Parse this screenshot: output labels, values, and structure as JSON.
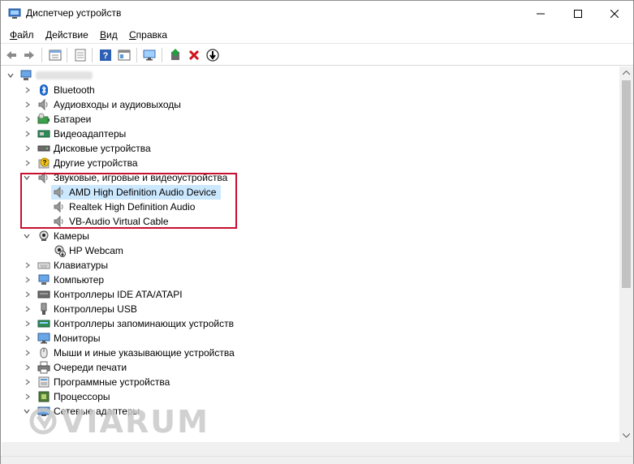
{
  "window": {
    "title": "Диспетчер устройств",
    "controls": {
      "minimize": "minimize",
      "maximize": "maximize",
      "close": "close"
    }
  },
  "menu": [
    {
      "key": "Ф",
      "rest": "айл"
    },
    {
      "key": "Д",
      "rest": "ействие"
    },
    {
      "key": "В",
      "rest": "ид"
    },
    {
      "key": "С",
      "rest": "правка"
    }
  ],
  "toolbar": [
    "back-icon",
    "forward-icon",
    "properties-icon",
    "show-hidden-icon",
    "help-icon",
    "view-icon",
    "monitor-icon",
    "update-driver-icon",
    "uninstall-icon",
    "scan-icon"
  ],
  "tree": {
    "root": "",
    "categories": [
      {
        "label": "Bluetooth",
        "icon": "bluetooth-icon",
        "expanded": false,
        "children": []
      },
      {
        "label": "Аудиовходы и аудиовыходы",
        "icon": "speaker-icon",
        "expanded": false,
        "children": []
      },
      {
        "label": "Батареи",
        "icon": "battery-icon",
        "expanded": false,
        "children": []
      },
      {
        "label": "Видеоадаптеры",
        "icon": "display-adapter-icon",
        "expanded": false,
        "children": []
      },
      {
        "label": "Дисковые устройства",
        "icon": "disk-icon",
        "expanded": false,
        "children": []
      },
      {
        "label": "Другие устройства",
        "icon": "unknown-device-icon",
        "expanded": false,
        "children": []
      },
      {
        "label": "Звуковые, игровые и видеоустройства",
        "icon": "speaker-icon",
        "expanded": true,
        "children": [
          {
            "label": "AMD High Definition Audio Device",
            "icon": "speaker-icon",
            "selected": true
          },
          {
            "label": "Realtek High Definition Audio",
            "icon": "speaker-icon",
            "selected": false
          },
          {
            "label": "VB-Audio Virtual Cable",
            "icon": "speaker-icon",
            "selected": false
          }
        ]
      },
      {
        "label": "Камеры",
        "icon": "camera-icon",
        "expanded": true,
        "children": [
          {
            "label": "HP Webcam",
            "icon": "webcam-icon",
            "selected": false
          }
        ]
      },
      {
        "label": "Клавиатуры",
        "icon": "keyboard-icon",
        "expanded": false,
        "children": []
      },
      {
        "label": "Компьютер",
        "icon": "computer-icon",
        "expanded": false,
        "children": []
      },
      {
        "label": "Контроллеры IDE ATA/ATAPI",
        "icon": "ide-controller-icon",
        "expanded": false,
        "children": []
      },
      {
        "label": "Контроллеры USB",
        "icon": "usb-icon",
        "expanded": false,
        "children": []
      },
      {
        "label": "Контроллеры запоминающих устройств",
        "icon": "storage-controller-icon",
        "expanded": false,
        "children": []
      },
      {
        "label": "Мониторы",
        "icon": "monitor-icon",
        "expanded": false,
        "children": []
      },
      {
        "label": "Мыши и иные указывающие устройства",
        "icon": "mouse-icon",
        "expanded": false,
        "children": []
      },
      {
        "label": "Очереди печати",
        "icon": "printer-icon",
        "expanded": false,
        "children": []
      },
      {
        "label": "Программные устройства",
        "icon": "software-device-icon",
        "expanded": false,
        "children": []
      },
      {
        "label": "Процессоры",
        "icon": "processor-icon",
        "expanded": false,
        "children": []
      },
      {
        "label": "Сетевые адаптеры",
        "icon": "network-adapter-icon",
        "expanded": true,
        "children": []
      }
    ]
  },
  "watermark": "VIARUM"
}
